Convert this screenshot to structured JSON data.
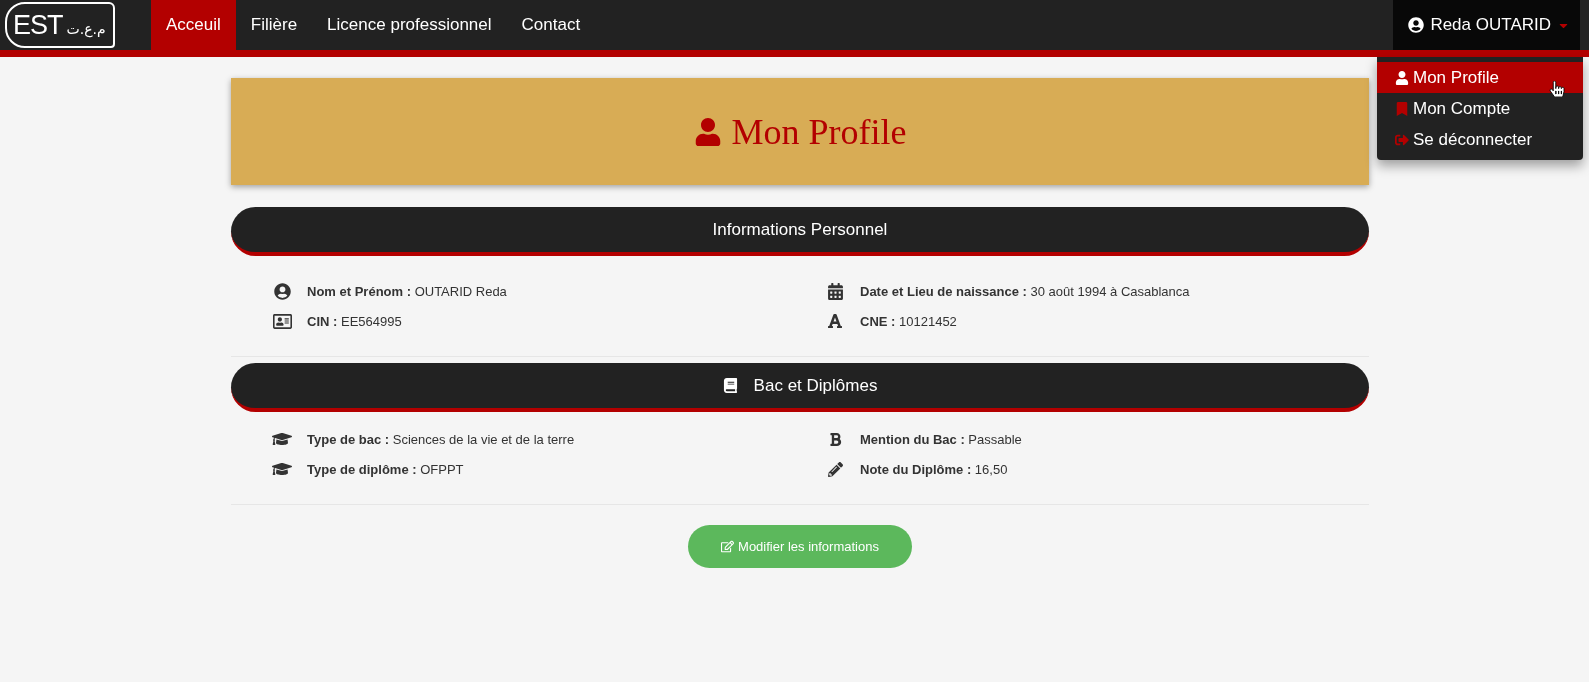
{
  "navbar": {
    "logo": {
      "latin": "EST",
      "arabic": "م.ع.ت"
    },
    "links": [
      {
        "label": "Acceuil",
        "selected": true
      },
      {
        "label": "Filière",
        "selected": false
      },
      {
        "label": "Licence professionnel",
        "selected": false
      },
      {
        "label": "Contact",
        "selected": false
      }
    ],
    "user_menu": {
      "label": "Reda OUTARID",
      "expanded": true,
      "items": [
        {
          "kind": "profile",
          "label": "Mon Profile",
          "selected": true
        },
        {
          "kind": "account",
          "label": "Mon Compte",
          "selected": false
        },
        {
          "kind": "logout",
          "label": "Se déconnecter",
          "selected": false
        }
      ]
    }
  },
  "banner": {
    "title": "Mon Profile"
  },
  "sections": [
    {
      "kind": "personal",
      "title": "Informations Personnel",
      "fields": [
        {
          "kind": "person",
          "text": "**Nom et Prénom :** OUTARID Reda"
        },
        {
          "kind": "calendar",
          "text": "**Date et Lieu de naissance :** 30 août 1994 à Casablanca"
        },
        {
          "kind": "id-card",
          "text": "**CIN :** EE564995"
        },
        {
          "kind": "font",
          "text": "**CNE :** 10121452"
        }
      ]
    },
    {
      "kind": "education",
      "title": "Bac et Diplômes",
      "fields": [
        {
          "kind": "cap",
          "text": "**Type de bac :** Sciences de la vie et de la terre"
        },
        {
          "kind": "bold",
          "text": "**Mention du Bac :** Passable"
        },
        {
          "kind": "cap",
          "text": "**Type de diplôme :** OFPPT"
        },
        {
          "kind": "pencil",
          "text": "**Note du Diplôme :** 16,50"
        }
      ]
    }
  ],
  "edit_button": {
    "label": "Modifier les informations"
  }
}
